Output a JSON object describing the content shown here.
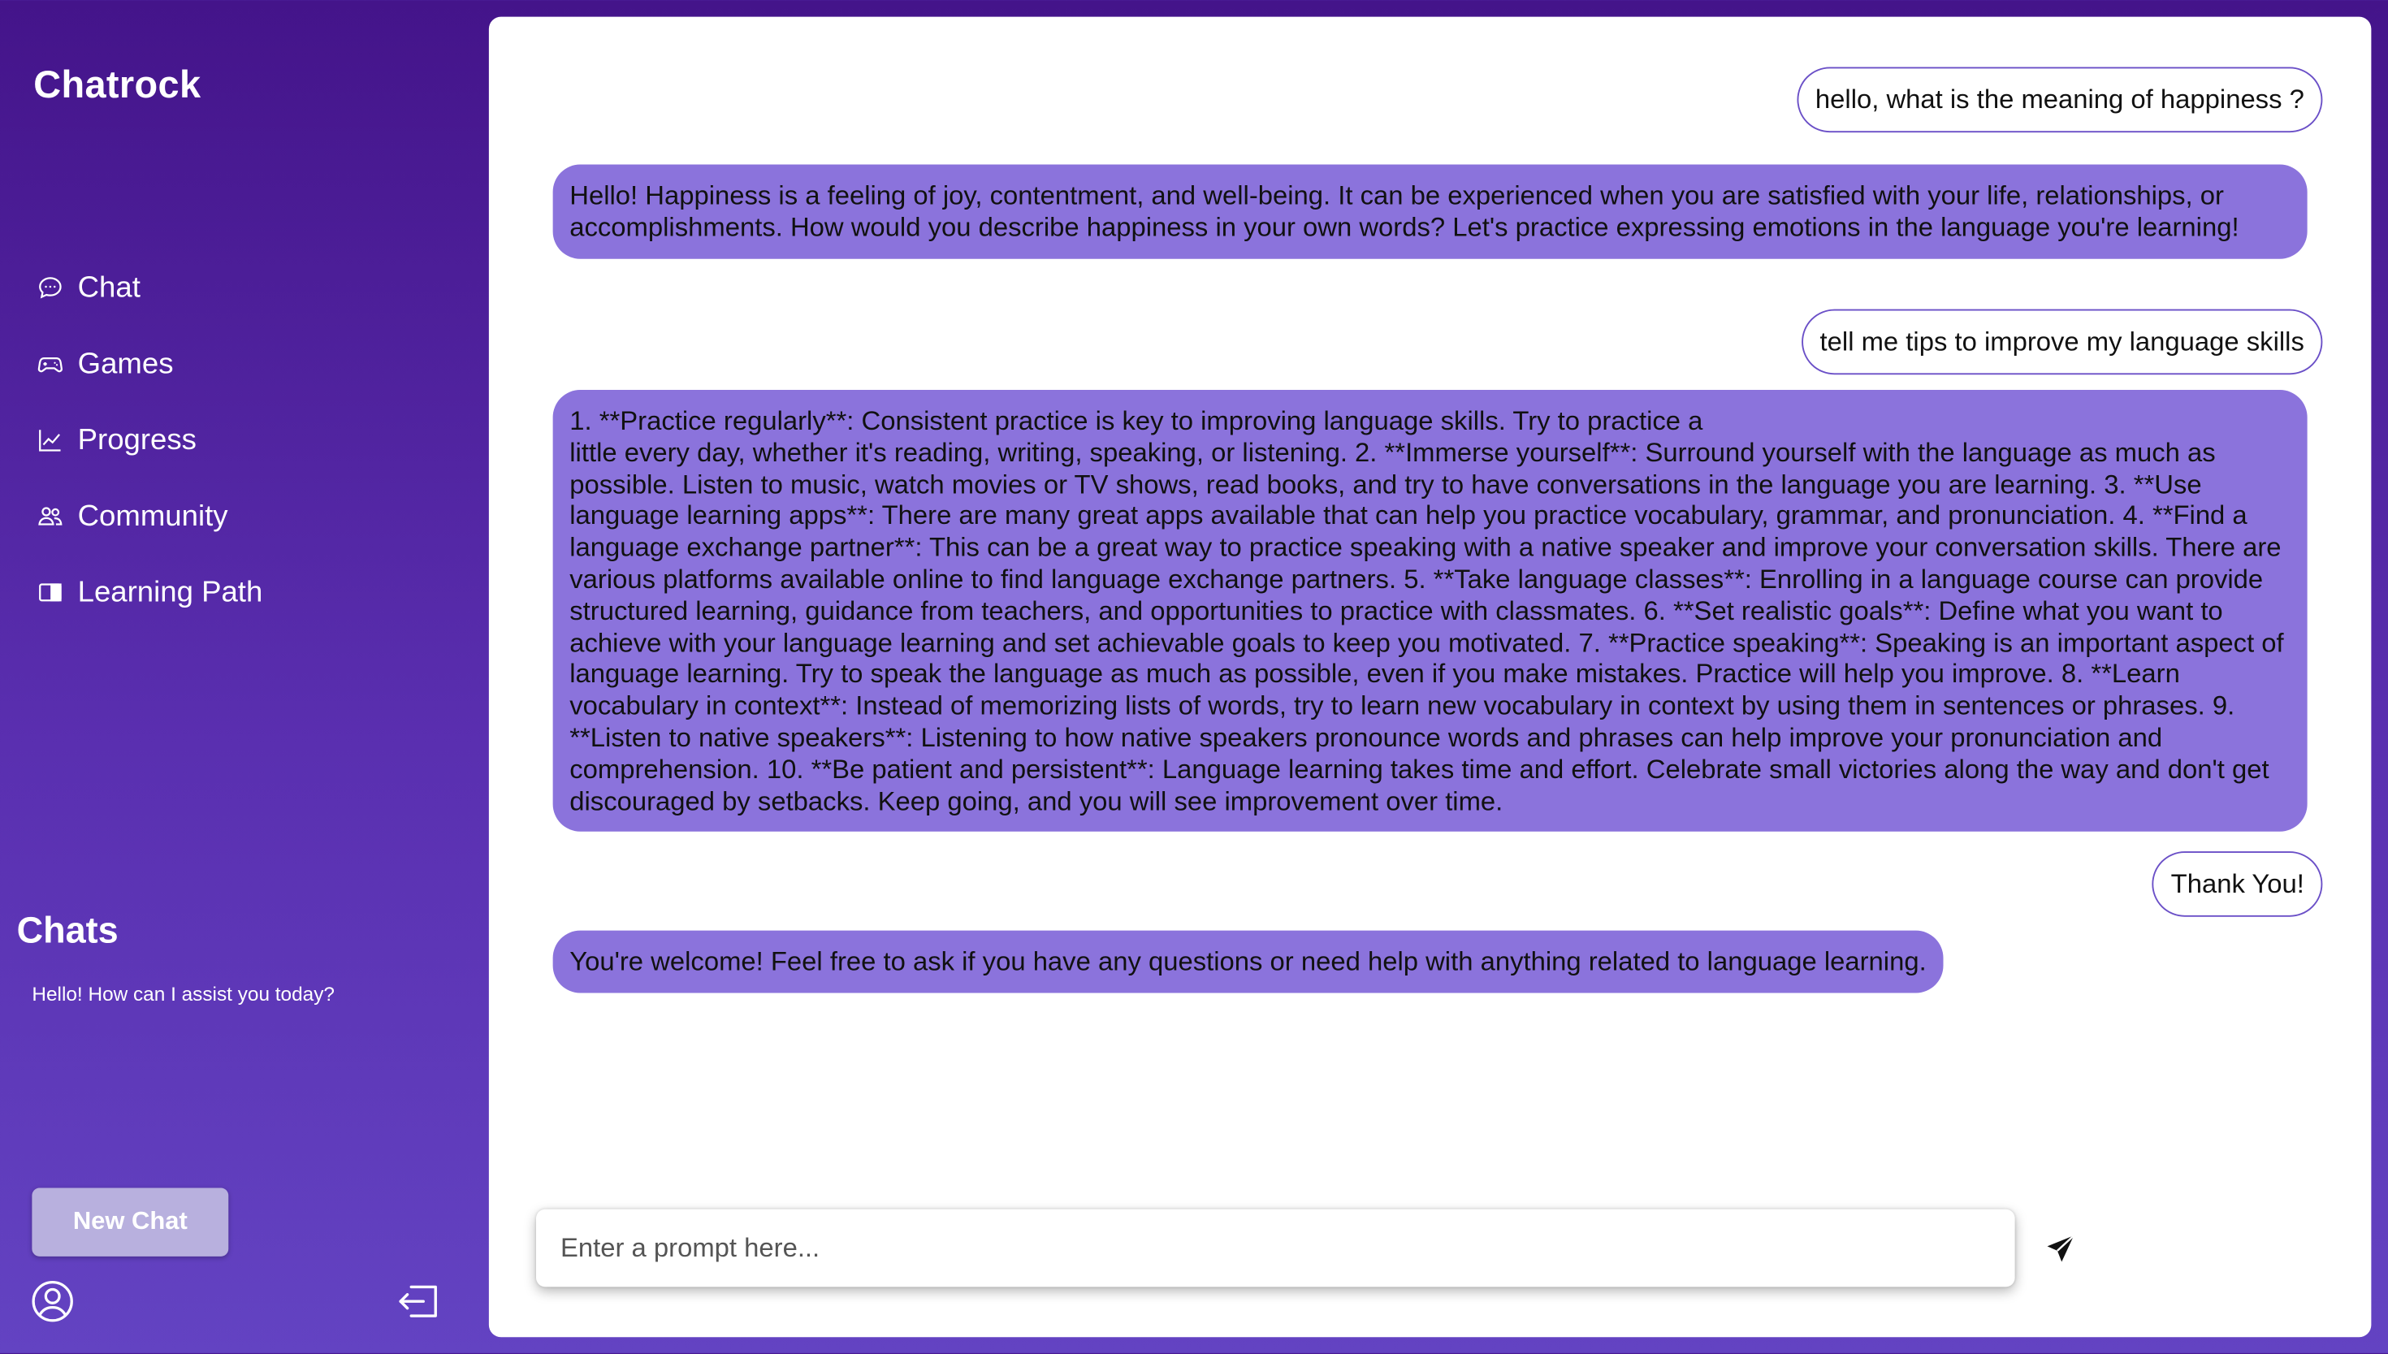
{
  "app": {
    "brand": "Chatrock"
  },
  "sidebar": {
    "nav": [
      {
        "label": "Chat",
        "icon": "chat-bubble-icon"
      },
      {
        "label": "Games",
        "icon": "gamepad-icon"
      },
      {
        "label": "Progress",
        "icon": "line-chart-icon"
      },
      {
        "label": "Community",
        "icon": "users-icon"
      },
      {
        "label": "Learning Path",
        "icon": "book-icon"
      }
    ],
    "chats_title": "Chats",
    "chat_history": [
      {
        "label": "Hello! How can I assist you today?"
      }
    ],
    "new_chat_label": "New Chat",
    "profile_icon": "user-circle-icon",
    "logout_icon": "logout-icon"
  },
  "conversation": [
    {
      "role": "user",
      "text": "hello, what is the meaning of happiness ?"
    },
    {
      "role": "assistant",
      "text": "Hello! Happiness is a feeling of joy, contentment, and well-being. It can be experienced when you are satisfied with your life, relationships, or accomplishments. How would you describe happiness in your own words? Let's practice expressing emotions in the language you're learning!"
    },
    {
      "role": "user",
      "text": "tell me tips to improve my language skills"
    },
    {
      "role": "assistant",
      "line1": "1. **Practice regularly**: Consistent practice is key to improving language skills. Try to practice a",
      "text": "little every day, whether it's reading, writing, speaking, or listening. 2. **Immerse yourself**: Surround yourself with the language as much as possible. Listen to music, watch movies or TV shows, read books, and try to have conversations in the language you are learning. 3. **Use language learning apps**: There are many great apps available that can help you practice vocabulary, grammar, and pronunciation. 4. **Find a language exchange partner**: This can be a great way to practice speaking with a native speaker and improve your conversation skills. There are various platforms available online to find language exchange partners. 5. **Take language classes**: Enrolling in a language course can provide structured learning, guidance from teachers, and opportunities to practice with classmates. 6. **Set realistic goals**: Define what you want to achieve with your language learning and set achievable goals to keep you motivated. 7. **Practice speaking**: Speaking is an important aspect of language learning. Try to speak the language as much as possible, even if you make mistakes. Practice will help you improve. 8. **Learn vocabulary in context**: Instead of memorizing lists of words, try to learn new vocabulary in context by using them in sentences or phrases. 9. **Listen to native speakers**: Listening to how native speakers pronounce words and phrases can help improve your pronunciation and comprehension. 10. **Be patient and persistent**: Language learning takes time and effort. Celebrate small victories along the way and don't get discouraged by setbacks. Keep going, and you will see improvement over time."
    },
    {
      "role": "user",
      "text": "Thank You!"
    },
    {
      "role": "assistant",
      "text": "You're welcome! Feel free to ask if you have any questions or need help with anything related to language learning."
    }
  ],
  "prompt": {
    "placeholder": "Enter a prompt here...",
    "value": "",
    "send_icon": "send-icon"
  },
  "colors": {
    "sidebar_gradient_top": "#44148a",
    "sidebar_gradient_bottom": "#6343c2",
    "assistant_bubble": "#8b73dc",
    "user_bubble_border": "#6a4fc7",
    "new_chat_button": "#b8b0de"
  }
}
